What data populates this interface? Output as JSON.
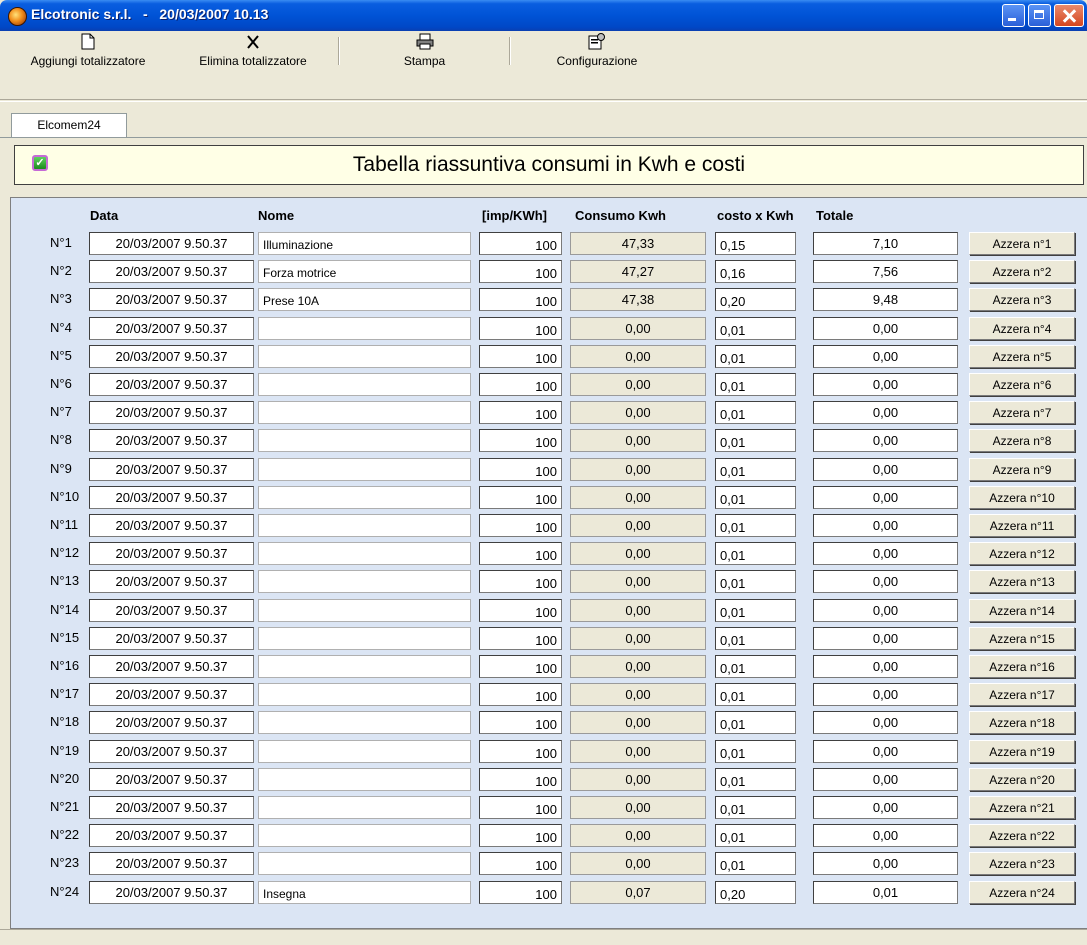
{
  "window": {
    "title": "Elcotronic s.r.l.   -   20/03/2007 10.13"
  },
  "toolbar": {
    "items": [
      {
        "label": "Aggiungi totalizzatore",
        "icon": "new-document-icon"
      },
      {
        "label": "Elimina totalizzatore",
        "icon": "delete-x-icon"
      },
      {
        "label": "Stampa",
        "icon": "printer-icon"
      },
      {
        "label": "Configurazione",
        "icon": "configuration-icon"
      }
    ]
  },
  "tab": {
    "label": "Elcomem24"
  },
  "header": {
    "title": "Tabella riassuntiva consumi in Kwh e costi"
  },
  "table": {
    "columns": {
      "data": "Data",
      "nome": "Nome",
      "imp": "[imp/KWh]",
      "consumo": "Consumo Kwh",
      "costo": "costo x Kwh",
      "totale": "Totale"
    },
    "rows": [
      {
        "n": "N°1",
        "data": "20/03/2007 9.50.37",
        "nome": "Illuminazione",
        "imp": "100",
        "consumo": "47,33",
        "costo": "0,15",
        "totale": "7,10",
        "button": "Azzera n°1"
      },
      {
        "n": "N°2",
        "data": "20/03/2007 9.50.37",
        "nome": "Forza motrice",
        "imp": "100",
        "consumo": "47,27",
        "costo": "0,16",
        "totale": "7,56",
        "button": "Azzera n°2"
      },
      {
        "n": "N°3",
        "data": "20/03/2007 9.50.37",
        "nome": "Prese 10A",
        "imp": "100",
        "consumo": "47,38",
        "costo": "0,20",
        "totale": "9,48",
        "button": "Azzera n°3"
      },
      {
        "n": "N°4",
        "data": "20/03/2007 9.50.37",
        "nome": "",
        "imp": "100",
        "consumo": "0,00",
        "costo": "0,01",
        "totale": "0,00",
        "button": "Azzera n°4"
      },
      {
        "n": "N°5",
        "data": "20/03/2007 9.50.37",
        "nome": "",
        "imp": "100",
        "consumo": "0,00",
        "costo": "0,01",
        "totale": "0,00",
        "button": "Azzera n°5"
      },
      {
        "n": "N°6",
        "data": "20/03/2007 9.50.37",
        "nome": "",
        "imp": "100",
        "consumo": "0,00",
        "costo": "0,01",
        "totale": "0,00",
        "button": "Azzera n°6"
      },
      {
        "n": "N°7",
        "data": "20/03/2007 9.50.37",
        "nome": "",
        "imp": "100",
        "consumo": "0,00",
        "costo": "0,01",
        "totale": "0,00",
        "button": "Azzera n°7"
      },
      {
        "n": "N°8",
        "data": "20/03/2007 9.50.37",
        "nome": "",
        "imp": "100",
        "consumo": "0,00",
        "costo": "0,01",
        "totale": "0,00",
        "button": "Azzera n°8"
      },
      {
        "n": "N°9",
        "data": "20/03/2007 9.50.37",
        "nome": "",
        "imp": "100",
        "consumo": "0,00",
        "costo": "0,01",
        "totale": "0,00",
        "button": "Azzera n°9"
      },
      {
        "n": "N°10",
        "data": "20/03/2007 9.50.37",
        "nome": "",
        "imp": "100",
        "consumo": "0,00",
        "costo": "0,01",
        "totale": "0,00",
        "button": "Azzera n°10"
      },
      {
        "n": "N°11",
        "data": "20/03/2007 9.50.37",
        "nome": "",
        "imp": "100",
        "consumo": "0,00",
        "costo": "0,01",
        "totale": "0,00",
        "button": "Azzera n°11"
      },
      {
        "n": "N°12",
        "data": "20/03/2007 9.50.37",
        "nome": "",
        "imp": "100",
        "consumo": "0,00",
        "costo": "0,01",
        "totale": "0,00",
        "button": "Azzera n°12"
      },
      {
        "n": "N°13",
        "data": "20/03/2007 9.50.37",
        "nome": "",
        "imp": "100",
        "consumo": "0,00",
        "costo": "0,01",
        "totale": "0,00",
        "button": "Azzera n°13"
      },
      {
        "n": "N°14",
        "data": "20/03/2007 9.50.37",
        "nome": "",
        "imp": "100",
        "consumo": "0,00",
        "costo": "0,01",
        "totale": "0,00",
        "button": "Azzera n°14"
      },
      {
        "n": "N°15",
        "data": "20/03/2007 9.50.37",
        "nome": "",
        "imp": "100",
        "consumo": "0,00",
        "costo": "0,01",
        "totale": "0,00",
        "button": "Azzera n°15"
      },
      {
        "n": "N°16",
        "data": "20/03/2007 9.50.37",
        "nome": "",
        "imp": "100",
        "consumo": "0,00",
        "costo": "0,01",
        "totale": "0,00",
        "button": "Azzera n°16"
      },
      {
        "n": "N°17",
        "data": "20/03/2007 9.50.37",
        "nome": "",
        "imp": "100",
        "consumo": "0,00",
        "costo": "0,01",
        "totale": "0,00",
        "button": "Azzera n°17"
      },
      {
        "n": "N°18",
        "data": "20/03/2007 9.50.37",
        "nome": "",
        "imp": "100",
        "consumo": "0,00",
        "costo": "0,01",
        "totale": "0,00",
        "button": "Azzera n°18"
      },
      {
        "n": "N°19",
        "data": "20/03/2007 9.50.37",
        "nome": "",
        "imp": "100",
        "consumo": "0,00",
        "costo": "0,01",
        "totale": "0,00",
        "button": "Azzera n°19"
      },
      {
        "n": "N°20",
        "data": "20/03/2007 9.50.37",
        "nome": "",
        "imp": "100",
        "consumo": "0,00",
        "costo": "0,01",
        "totale": "0,00",
        "button": "Azzera n°20"
      },
      {
        "n": "N°21",
        "data": "20/03/2007 9.50.37",
        "nome": "",
        "imp": "100",
        "consumo": "0,00",
        "costo": "0,01",
        "totale": "0,00",
        "button": "Azzera n°21"
      },
      {
        "n": "N°22",
        "data": "20/03/2007 9.50.37",
        "nome": "",
        "imp": "100",
        "consumo": "0,00",
        "costo": "0,01",
        "totale": "0,00",
        "button": "Azzera n°22"
      },
      {
        "n": "N°23",
        "data": "20/03/2007 9.50.37",
        "nome": "",
        "imp": "100",
        "consumo": "0,00",
        "costo": "0,01",
        "totale": "0,00",
        "button": "Azzera n°23"
      },
      {
        "n": "N°24",
        "data": "20/03/2007 9.50.37",
        "nome": "Insegna",
        "imp": "100",
        "consumo": "0,07",
        "costo": "0,20",
        "totale": "0,01",
        "button": "Azzera n°24"
      }
    ]
  }
}
